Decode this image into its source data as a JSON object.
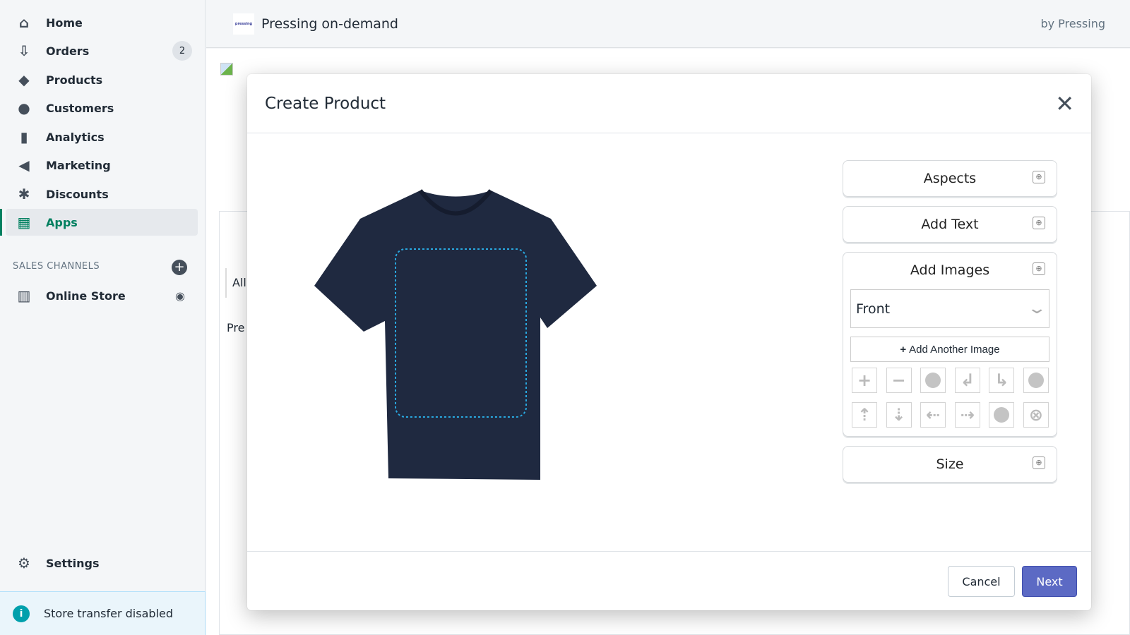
{
  "sidebar": {
    "items": [
      {
        "label": "Home",
        "icon": "home-icon",
        "glyph": "⌂"
      },
      {
        "label": "Orders",
        "icon": "orders-icon",
        "glyph": "⇩",
        "badge": "2"
      },
      {
        "label": "Products",
        "icon": "tag-icon",
        "glyph": "◆"
      },
      {
        "label": "Customers",
        "icon": "person-icon",
        "glyph": "●"
      },
      {
        "label": "Analytics",
        "icon": "bar-chart-icon",
        "glyph": "▮"
      },
      {
        "label": "Marketing",
        "icon": "megaphone-icon",
        "glyph": "◀"
      },
      {
        "label": "Discounts",
        "icon": "discount-icon",
        "glyph": "✱"
      },
      {
        "label": "Apps",
        "icon": "apps-icon",
        "glyph": "▦",
        "active": true
      }
    ],
    "sales_channels_title": "SALES CHANNELS",
    "online_store": "Online Store",
    "settings": "Settings",
    "transfer_notice": "Store transfer disabled"
  },
  "topbar": {
    "logo_text": "pressing",
    "title": "Pressing on-demand",
    "by": "by Pressing"
  },
  "background": {
    "tab_all": "All",
    "text_pre": "Pre"
  },
  "modal": {
    "title": "Create Product",
    "panel": {
      "aspects": "Aspects",
      "add_text": "Add Text",
      "add_images": "Add Images",
      "view_select": "Front",
      "add_another_image": "Add Another Image",
      "size": "Size"
    },
    "cancel": "Cancel",
    "next": "Next"
  },
  "colors": {
    "accent": "#5c6ac4",
    "shirt": "#1f2940",
    "print_area": "#29a8e0",
    "active_nav": "#008060"
  }
}
